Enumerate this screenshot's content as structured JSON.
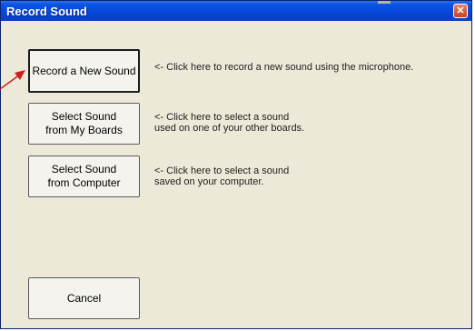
{
  "window": {
    "title": "Record Sound"
  },
  "buttons": {
    "record_new": "Record a New Sound",
    "from_boards": "Select Sound\nfrom My Boards",
    "from_computer": "Select Sound\nfrom Computer",
    "cancel": "Cancel"
  },
  "hints": {
    "record_new": "<- Click here to record a new sound using the microphone.",
    "from_boards": "<- Click here to select a sound\n    used on one of your other boards.",
    "from_computer": "<- Click here to select a sound\n    saved on your computer."
  },
  "icons": {
    "close": "close-icon",
    "pointer_arrow": "pointer-arrow-icon"
  },
  "colors": {
    "titlebar": "#0546d6",
    "window_bg": "#ece9d8",
    "close_button": "#c7401f",
    "annotation_arrow": "#cc1f1f"
  }
}
